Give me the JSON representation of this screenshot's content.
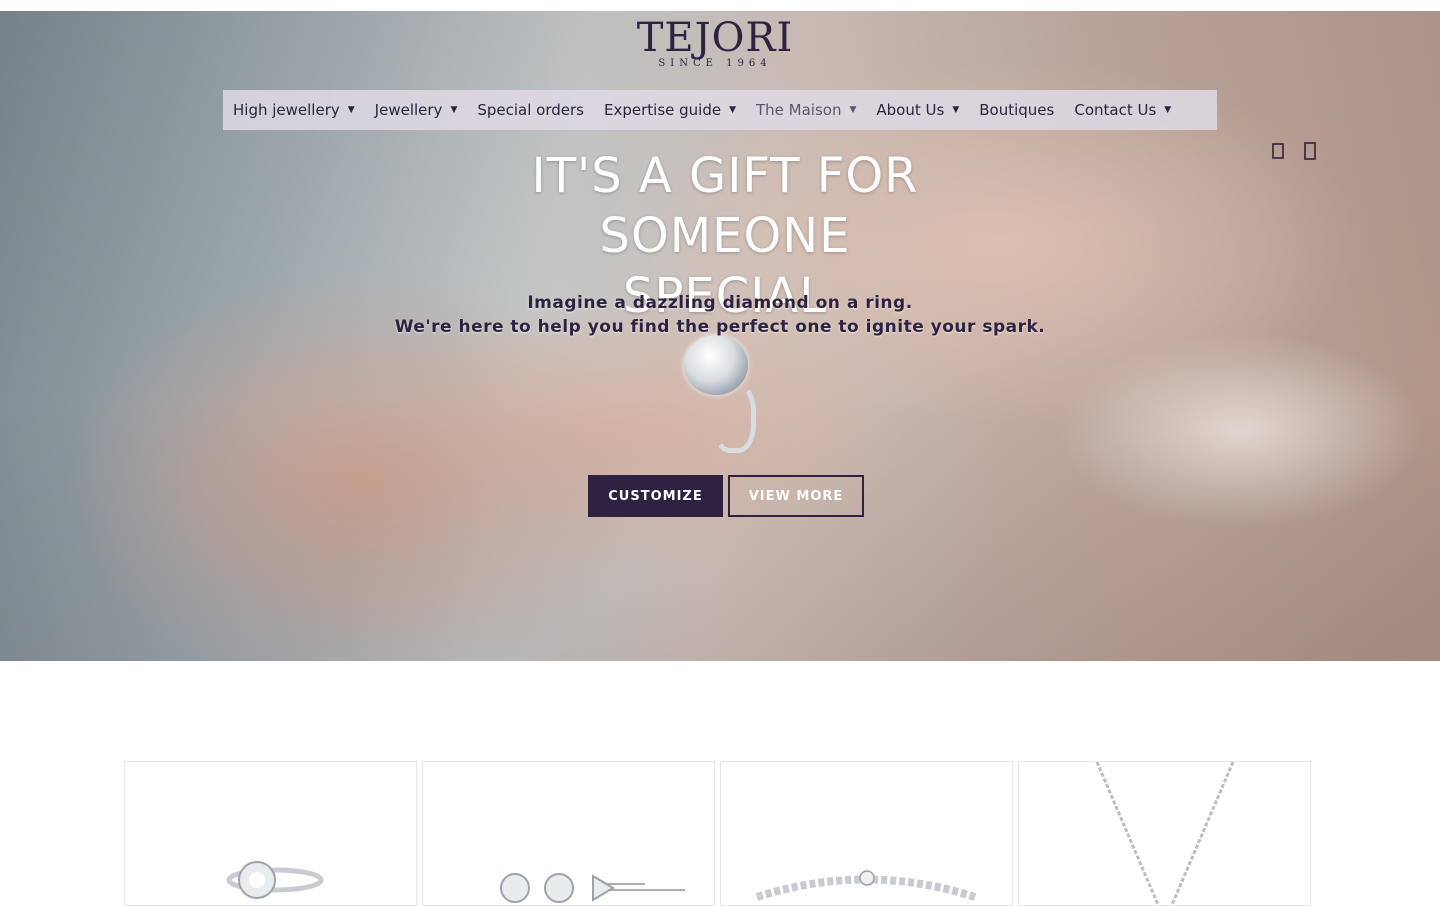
{
  "brand": {
    "name": "TEJORI",
    "since": "SINCE 1964"
  },
  "nav": {
    "items": [
      {
        "label": "High jewellery",
        "dropdown": true
      },
      {
        "label": "Jewellery",
        "dropdown": true
      },
      {
        "label": "Special orders",
        "dropdown": false
      },
      {
        "label": "Expertise guide",
        "dropdown": true
      },
      {
        "label": "The Maison",
        "dropdown": true
      },
      {
        "label": "About Us",
        "dropdown": true
      },
      {
        "label": "Boutiques",
        "dropdown": false
      },
      {
        "label": "Contact Us",
        "dropdown": true
      }
    ]
  },
  "header_icons": {
    "search": "search-icon",
    "account": "user-icon"
  },
  "hero": {
    "headline": "IT'S A GIFT FOR SOMEONE SPECIAL",
    "subline_1": "Imagine a dazzling diamond on a ring.",
    "subline_2": "We're here to help you find the perfect one to ignite your spark.",
    "cta_primary": "CUSTOMIZE",
    "cta_secondary": "VIEW MORE"
  },
  "colors": {
    "primary": "#2e2142",
    "nav_bg": "#ded8e2",
    "text_dark": "#2e2240"
  },
  "products": [
    {
      "image": "diamond-ring"
    },
    {
      "image": "diamond-earrings"
    },
    {
      "image": "diamond-bracelet"
    },
    {
      "image": "diamond-necklace"
    }
  ]
}
